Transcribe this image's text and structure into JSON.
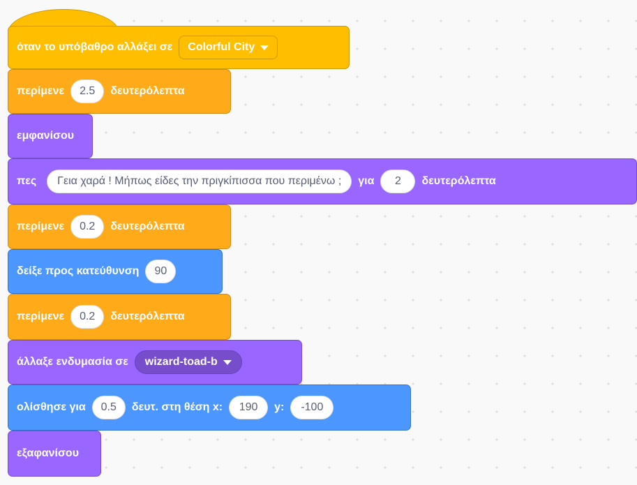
{
  "colors": {
    "events": "#ffbf00",
    "control": "#ffab19",
    "looks": "#9966ff",
    "motion": "#4c97ff",
    "background": "#f9f9f9"
  },
  "script": {
    "b1": {
      "label": "όταν το υπόβαθρο αλλάξει σε",
      "dropdown": "Colorful City"
    },
    "b2": {
      "label": "περίμενε",
      "value": "2.5",
      "suffix": "δευτερόλεπτα"
    },
    "b3": {
      "label": "εμφανίσου"
    },
    "b4": {
      "label": "πες",
      "text": "Γεια χαρά ! Μήπως είδες την πριγκίπισσα που περιμένω ;",
      "mid": "για",
      "value": "2",
      "suffix": "δευτερόλεπτα"
    },
    "b5": {
      "label": "περίμενε",
      "value": "0.2",
      "suffix": "δευτερόλεπτα"
    },
    "b6": {
      "label": "δείξε προς κατεύθυνση",
      "value": "90"
    },
    "b7": {
      "label": "περίμενε",
      "value": "0.2",
      "suffix": "δευτερόλεπτα"
    },
    "b8": {
      "label": "άλλαξε ενδυμασία σε",
      "dropdown": "wizard-toad-b"
    },
    "b9": {
      "label": "ολίσθησε για",
      "secs": "0.5",
      "mid": "δευτ. στη θέση x:",
      "x": "190",
      "ylabel": "y:",
      "y": "-100"
    },
    "b10": {
      "label": "εξαφανίσου"
    }
  }
}
